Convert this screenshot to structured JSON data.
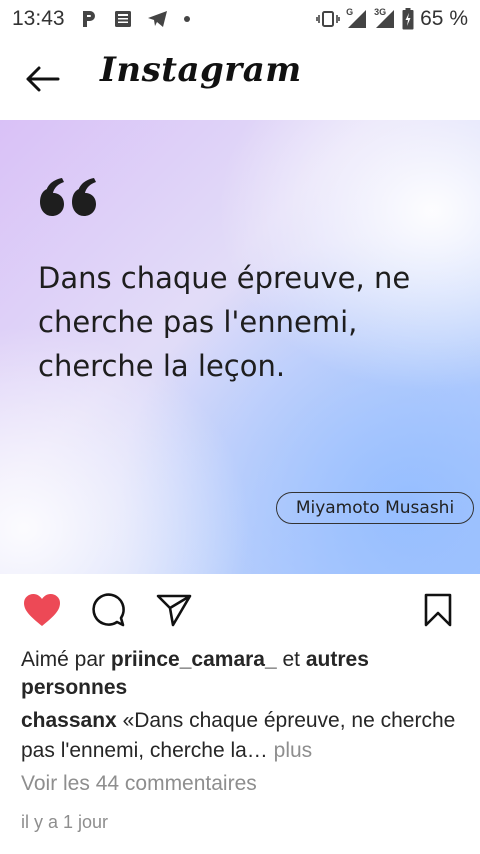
{
  "status": {
    "time": "13:43",
    "battery": "65 %",
    "icons_left": [
      "p-icon",
      "news-icon",
      "telegram-icon",
      "dot-icon"
    ],
    "icons_right": [
      "vibrate-icon",
      "signal-g-icon",
      "signal-3g-icon",
      "battery-icon"
    ],
    "net1": "G",
    "net2": "3G"
  },
  "header": {
    "title": "Instagram"
  },
  "post": {
    "quote": "Dans chaque épreuve, ne cherche pas l'ennemi, cherche la leçon.",
    "author": "Miyamoto Musashi",
    "gradient_colors": [
      "#d9c1f7",
      "#e2dcf8",
      "#c9d6fb",
      "#a9c7fd"
    ]
  },
  "actions": {
    "like_color": "#ed4956",
    "liked": true
  },
  "likes": {
    "prefix": "Aimé par ",
    "user": "priince_camara_",
    "middle": " et ",
    "others": "autres personnes"
  },
  "caption": {
    "user": "chassanx",
    "text": " «Dans chaque épreuve, ne cherche pas l'ennemi, cherche la…",
    "more": " plus"
  },
  "comments_link": "Voir les 44 commentaires",
  "timestamp": "il y a 1 jour"
}
